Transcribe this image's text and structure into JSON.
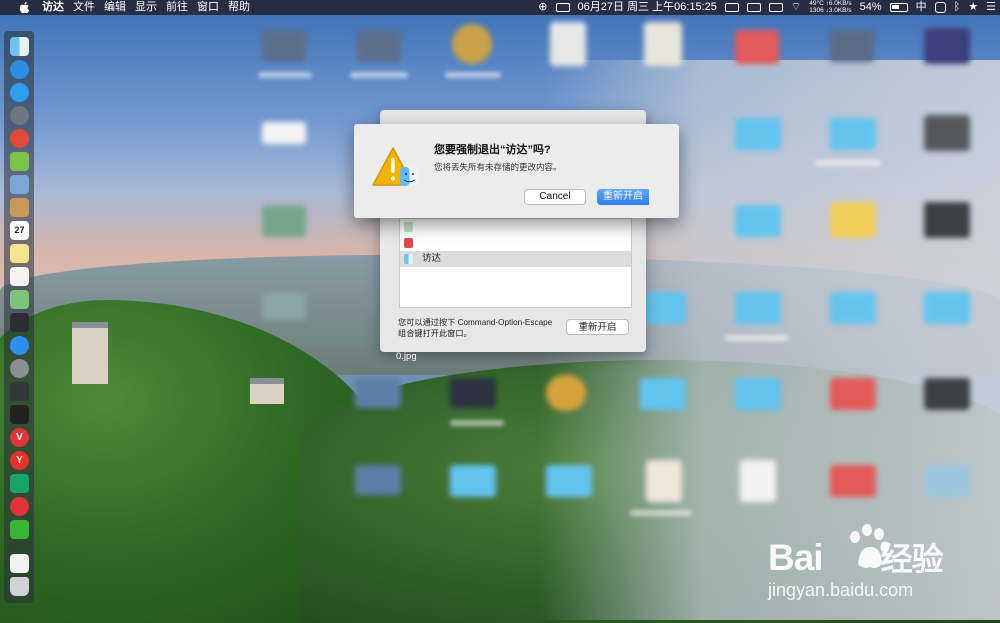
{
  "menubar": {
    "items": [
      "访达",
      "文件",
      "编辑",
      "显示",
      "前往",
      "窗口",
      "帮助"
    ],
    "status": {
      "datetime": "06月27日 周三 上午06:15:25",
      "net_line1": "49°C ↑6.0KB/s",
      "net_line2": "1306 ↓3.0KB/s",
      "battery": "54%",
      "input_method": "中"
    }
  },
  "force_quit": {
    "list_items": [
      {
        "label": ""
      },
      {
        "label": ""
      },
      {
        "label": "访达"
      }
    ],
    "hint": "您可以通过按下 Command-Option-Escape 组合键打开此窗口。",
    "relaunch_label": "重新开启"
  },
  "filename_fragment": "0.jpg",
  "alert": {
    "title": "您要强制退出“访达”吗?",
    "message": "您将丢失所有未存储的更改内容。",
    "cancel_label": "Cancel",
    "relaunch_label": "重新开启"
  },
  "watermark": {
    "brand": "Bai",
    "brand_suffix": "经验",
    "url": "jingyan.baidu.com"
  },
  "colors": {
    "accent": "#2c7ee8",
    "warning": "#f2b400"
  }
}
